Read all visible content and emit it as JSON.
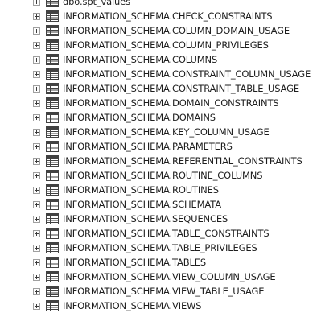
{
  "object_explorer": {
    "nodes": [
      {
        "label": "dbo.spt_values",
        "icon": "table-icon"
      },
      {
        "label": "INFORMATION_SCHEMA.CHECK_CONSTRAINTS",
        "icon": "table-icon"
      },
      {
        "label": "INFORMATION_SCHEMA.COLUMN_DOMAIN_USAGE",
        "icon": "table-icon"
      },
      {
        "label": "INFORMATION_SCHEMA.COLUMN_PRIVILEGES",
        "icon": "table-icon"
      },
      {
        "label": "INFORMATION_SCHEMA.COLUMNS",
        "icon": "table-icon"
      },
      {
        "label": "INFORMATION_SCHEMA.CONSTRAINT_COLUMN_USAGE",
        "icon": "table-icon"
      },
      {
        "label": "INFORMATION_SCHEMA.CONSTRAINT_TABLE_USAGE",
        "icon": "table-icon"
      },
      {
        "label": "INFORMATION_SCHEMA.DOMAIN_CONSTRAINTS",
        "icon": "table-icon"
      },
      {
        "label": "INFORMATION_SCHEMA.DOMAINS",
        "icon": "table-icon"
      },
      {
        "label": "INFORMATION_SCHEMA.KEY_COLUMN_USAGE",
        "icon": "table-icon"
      },
      {
        "label": "INFORMATION_SCHEMA.PARAMETERS",
        "icon": "table-icon"
      },
      {
        "label": "INFORMATION_SCHEMA.REFERENTIAL_CONSTRAINTS",
        "icon": "table-icon"
      },
      {
        "label": "INFORMATION_SCHEMA.ROUTINE_COLUMNS",
        "icon": "table-icon"
      },
      {
        "label": "INFORMATION_SCHEMA.ROUTINES",
        "icon": "table-icon"
      },
      {
        "label": "INFORMATION_SCHEMA.SCHEMATA",
        "icon": "table-icon"
      },
      {
        "label": "INFORMATION_SCHEMA.SEQUENCES",
        "icon": "table-icon"
      },
      {
        "label": "INFORMATION_SCHEMA.TABLE_CONSTRAINTS",
        "icon": "table-icon"
      },
      {
        "label": "INFORMATION_SCHEMA.TABLE_PRIVILEGES",
        "icon": "table-icon"
      },
      {
        "label": "INFORMATION_SCHEMA.TABLES",
        "icon": "table-icon"
      },
      {
        "label": "INFORMATION_SCHEMA.VIEW_COLUMN_USAGE",
        "icon": "table-icon"
      },
      {
        "label": "INFORMATION_SCHEMA.VIEW_TABLE_USAGE",
        "icon": "table-icon"
      },
      {
        "label": "INFORMATION_SCHEMA.VIEWS",
        "icon": "table-icon"
      }
    ]
  }
}
